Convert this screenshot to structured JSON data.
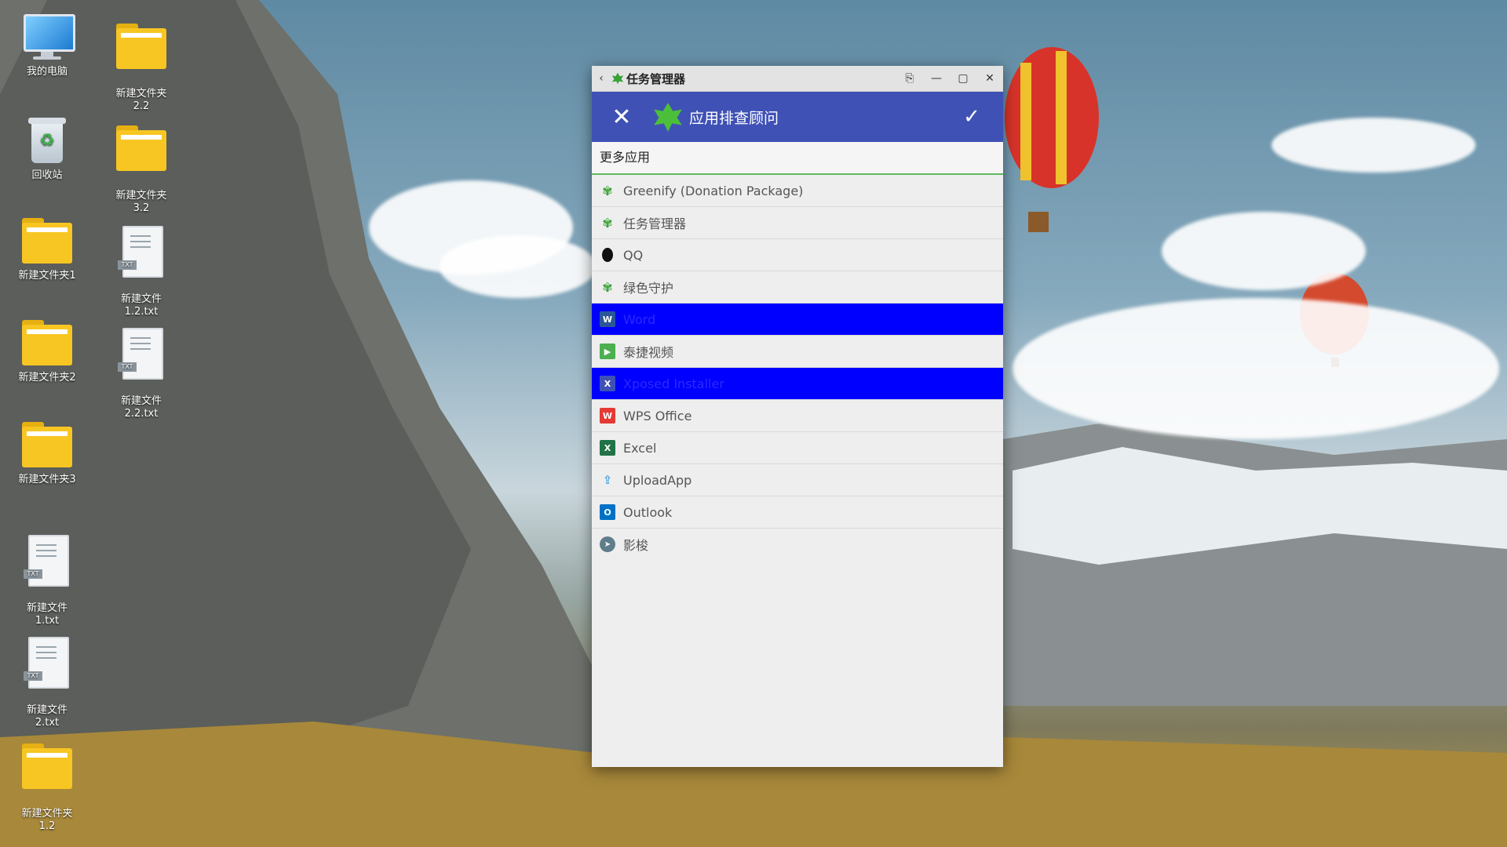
{
  "desktop": {
    "icons": [
      {
        "label": "我的电脑",
        "type": "pc"
      },
      {
        "label": "回收站",
        "type": "bin"
      },
      {
        "label": "新建文件夹1",
        "type": "folder"
      },
      {
        "label": "新建文件夹2",
        "type": "folder"
      },
      {
        "label": "新建文件夹3",
        "type": "folder"
      },
      {
        "label": "新建文件\n1.txt",
        "type": "txt"
      },
      {
        "label": "新建文件\n2.txt",
        "type": "txt"
      },
      {
        "label": "新建文件夹\n1.2",
        "type": "folder"
      },
      {
        "label": "新建文件夹\n2.2",
        "type": "folder"
      },
      {
        "label": "新建文件夹\n3.2",
        "type": "folder"
      },
      {
        "label": "新建文件\n1.2.txt",
        "type": "txt"
      },
      {
        "label": "新建文件\n2.2.txt",
        "type": "txt"
      }
    ],
    "txt_badge": "TXT"
  },
  "window": {
    "title": "任务管理器",
    "back_icon": "‹",
    "buttons": {
      "pin": "⎘",
      "minimize": "—",
      "maximize": "▢",
      "close": "✕"
    },
    "appbar": {
      "title": "应用排查顾问",
      "close_icon": "✕",
      "confirm_icon": "✓"
    },
    "section_header": "更多应用",
    "apps": [
      {
        "label": "Greenify (Donation Package)",
        "icon": "leaf-icon",
        "color": "#3aa13a",
        "selected": false
      },
      {
        "label": "任务管理器",
        "icon": "leaf-icon",
        "color": "#3aa13a",
        "selected": false
      },
      {
        "label": "QQ",
        "icon": "penguin-icon",
        "color": "#111111",
        "selected": false
      },
      {
        "label": "绿色守护",
        "icon": "leaf-icon",
        "color": "#3aa13a",
        "selected": false
      },
      {
        "label": "Word",
        "icon": "word-icon",
        "color": "#2b579a",
        "selected": true
      },
      {
        "label": "泰捷视频",
        "icon": "video-icon",
        "color": "#4caf50",
        "selected": false
      },
      {
        "label": "Xposed Installer",
        "icon": "xposed-icon",
        "color": "#3f51b5",
        "selected": true
      },
      {
        "label": "WPS Office",
        "icon": "wps-icon",
        "color": "#e53935",
        "selected": false
      },
      {
        "label": "Excel",
        "icon": "excel-icon",
        "color": "#217346",
        "selected": false
      },
      {
        "label": "UploadApp",
        "icon": "upload-icon",
        "color": "#4aa3e0",
        "selected": false
      },
      {
        "label": "Outlook",
        "icon": "outlook-icon",
        "color": "#0072c6",
        "selected": false
      },
      {
        "label": "影梭",
        "icon": "shadowsocks-icon",
        "color": "#607d8b",
        "selected": false
      }
    ]
  }
}
